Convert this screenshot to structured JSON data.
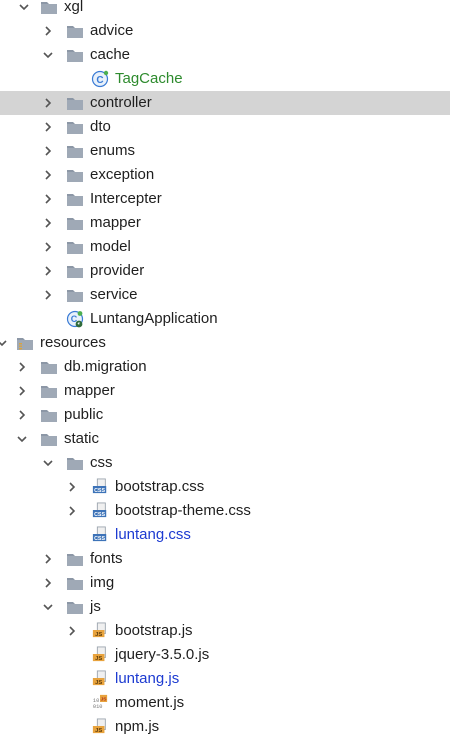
{
  "tree": [
    {
      "label": "xgl",
      "type": "folder",
      "expanded": true
    },
    {
      "label": "advice",
      "type": "folder",
      "expanded": false
    },
    {
      "label": "cache",
      "type": "folder",
      "expanded": true
    },
    {
      "label": "TagCache",
      "type": "java-class",
      "color": "#2e8b2e"
    },
    {
      "label": "controller",
      "type": "folder",
      "expanded": false,
      "selected": true
    },
    {
      "label": "dto",
      "type": "folder",
      "expanded": false
    },
    {
      "label": "enums",
      "type": "folder",
      "expanded": false
    },
    {
      "label": "exception",
      "type": "folder",
      "expanded": false
    },
    {
      "label": "Intercepter",
      "type": "folder",
      "expanded": false
    },
    {
      "label": "mapper",
      "type": "folder",
      "expanded": false
    },
    {
      "label": "model",
      "type": "folder",
      "expanded": false
    },
    {
      "label": "provider",
      "type": "folder",
      "expanded": false
    },
    {
      "label": "service",
      "type": "folder",
      "expanded": false
    },
    {
      "label": "LuntangApplication",
      "type": "spring-app"
    },
    {
      "label": "resources",
      "type": "resources-folder",
      "expanded": true
    },
    {
      "label": "db.migration",
      "type": "folder",
      "expanded": false
    },
    {
      "label": "mapper",
      "type": "folder",
      "expanded": false
    },
    {
      "label": "public",
      "type": "folder",
      "expanded": false
    },
    {
      "label": "static",
      "type": "folder",
      "expanded": true
    },
    {
      "label": "css",
      "type": "folder",
      "expanded": true
    },
    {
      "label": "bootstrap.css",
      "type": "css-file",
      "expanded": false
    },
    {
      "label": "bootstrap-theme.css",
      "type": "css-file",
      "expanded": false
    },
    {
      "label": "luntang.css",
      "type": "css-file",
      "color": "#1d3bd1"
    },
    {
      "label": "fonts",
      "type": "folder",
      "expanded": false
    },
    {
      "label": "img",
      "type": "folder",
      "expanded": false
    },
    {
      "label": "js",
      "type": "folder",
      "expanded": true
    },
    {
      "label": "bootstrap.js",
      "type": "js-file",
      "expanded": false
    },
    {
      "label": "jquery-3.5.0.js",
      "type": "js-file"
    },
    {
      "label": "luntang.js",
      "type": "js-file",
      "color": "#1d3bd1"
    },
    {
      "label": "moment.js",
      "type": "js-file-alt"
    },
    {
      "label": "npm.js",
      "type": "js-file"
    }
  ],
  "colors": {
    "selection": "#d4d4d4",
    "folder": "#8c97a6",
    "green": "#2e8b2e",
    "blue": "#1d3bd1"
  }
}
